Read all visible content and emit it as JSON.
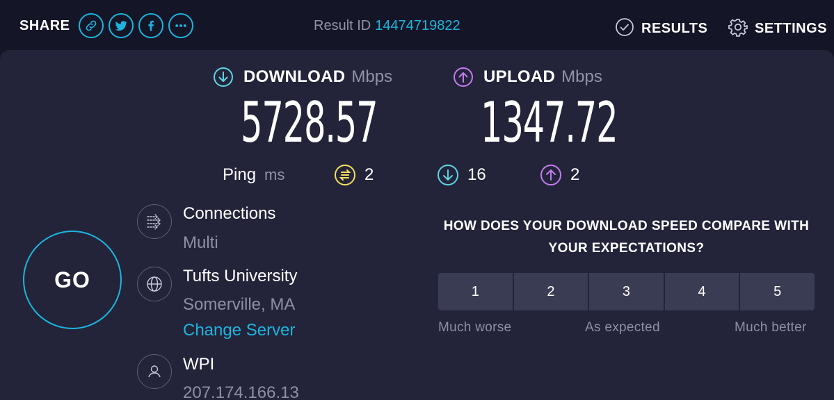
{
  "header": {
    "share_label": "SHARE",
    "share_buttons": [
      {
        "icon": "link-icon"
      },
      {
        "icon": "twitter-icon"
      },
      {
        "icon": "facebook-icon"
      },
      {
        "icon": "more-icon"
      }
    ],
    "result_id_label": "Result ID",
    "result_id_value": "14474719822",
    "results_label": "RESULTS",
    "settings_label": "SETTINGS"
  },
  "speeds": {
    "download": {
      "title": "DOWNLOAD",
      "unit": "Mbps",
      "value": "5728.57"
    },
    "upload": {
      "title": "UPLOAD",
      "unit": "Mbps",
      "value": "1347.72"
    }
  },
  "ping": {
    "label": "Ping",
    "unit": "ms",
    "idle": "2",
    "download": "16",
    "upload": "2"
  },
  "go_label": "GO",
  "info": {
    "connections": {
      "title": "Connections",
      "value": "Multi"
    },
    "server": {
      "title": "Tufts University",
      "location": "Somerville, MA",
      "change_label": "Change Server"
    },
    "isp": {
      "title": "WPI",
      "ip": "207.174.166.13"
    }
  },
  "survey": {
    "question": "HOW DOES YOUR DOWNLOAD SPEED COMPARE WITH YOUR EXPECTATIONS?",
    "ratings": [
      "1",
      "2",
      "3",
      "4",
      "5"
    ],
    "scale_low": "Much worse",
    "scale_mid": "As expected",
    "scale_high": "Much better"
  },
  "colors": {
    "accent": "#1cb5e0",
    "download": "#5fd5e4",
    "upload": "#c57bf0",
    "idle_ping": "#f6e05e",
    "background": "#141526",
    "panel": "#23243a"
  }
}
